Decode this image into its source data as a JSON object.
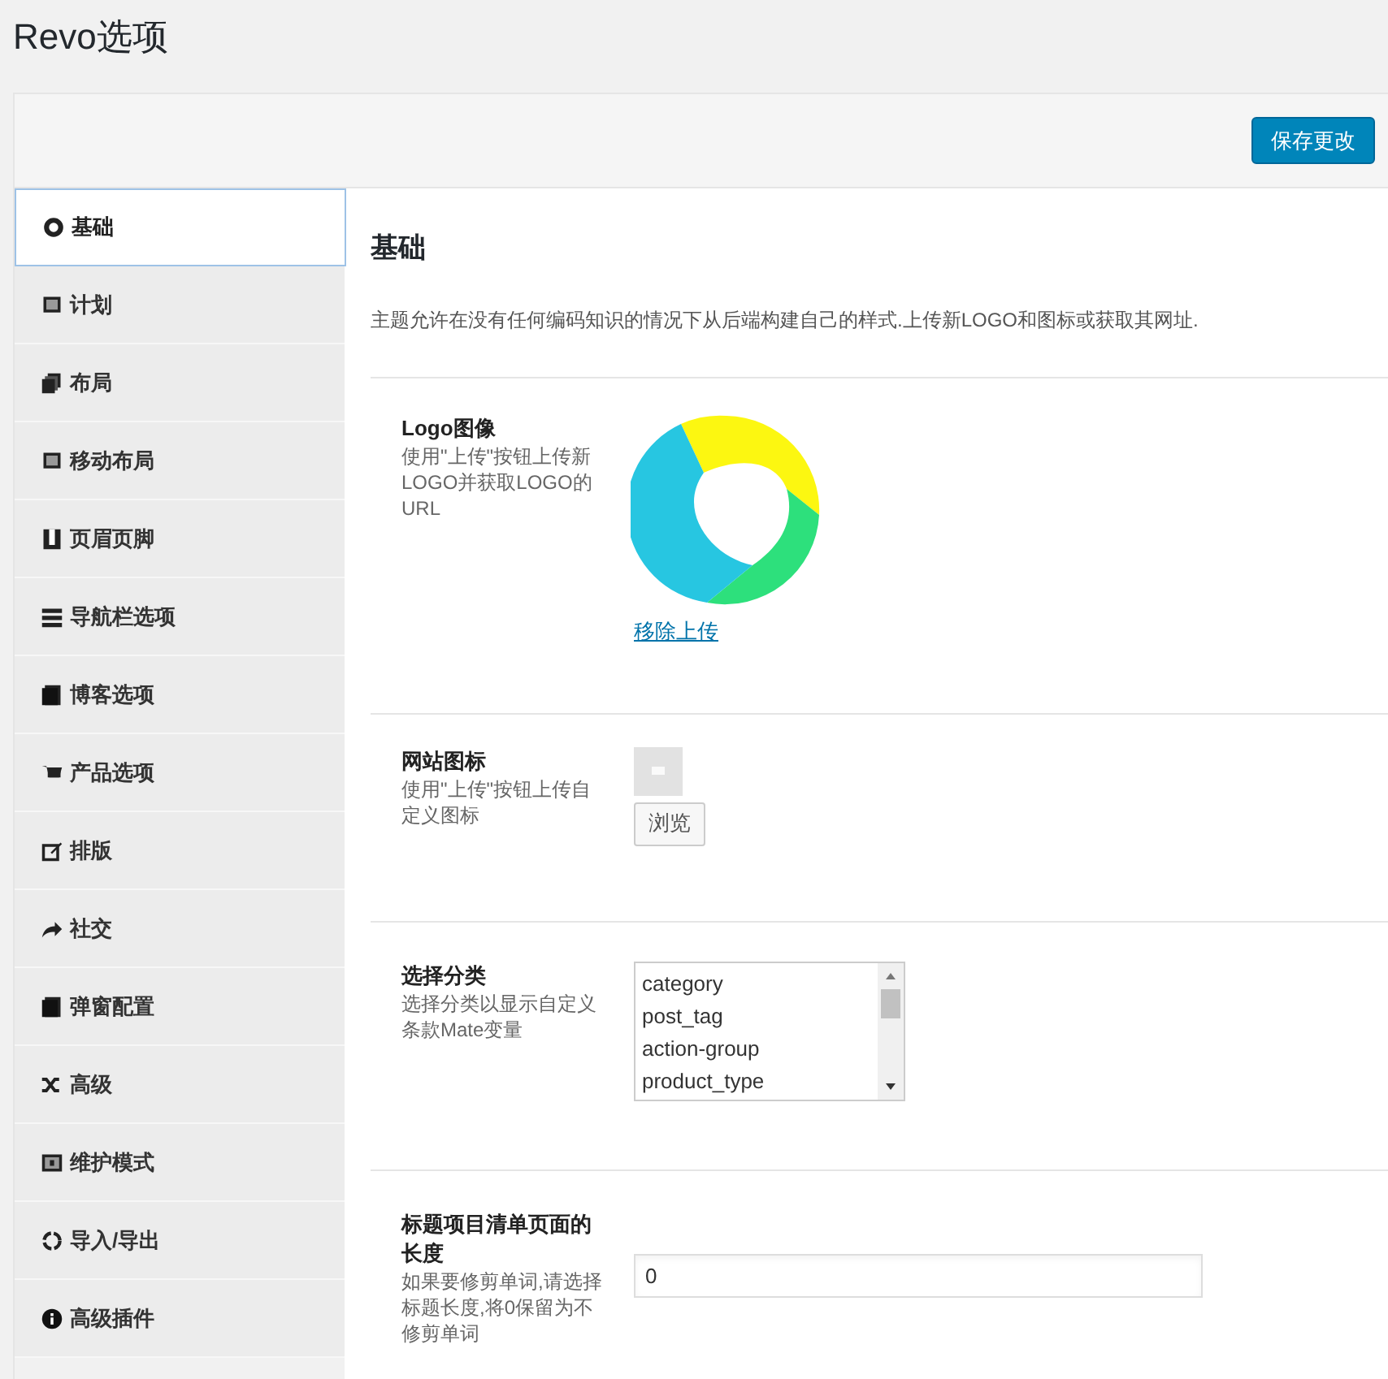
{
  "page_title": "Revo选项",
  "save_button": "保存更改",
  "sidebar": {
    "items": [
      {
        "label": "基础",
        "selected": true
      },
      {
        "label": "计划",
        "selected": false
      },
      {
        "label": "布局",
        "selected": false
      },
      {
        "label": "移动布局",
        "selected": false
      },
      {
        "label": "页眉页脚",
        "selected": false
      },
      {
        "label": "导航栏选项",
        "selected": false
      },
      {
        "label": "博客选项",
        "selected": false
      },
      {
        "label": "产品选项",
        "selected": false
      },
      {
        "label": "排版",
        "selected": false
      },
      {
        "label": "社交",
        "selected": false
      },
      {
        "label": "弹窗配置",
        "selected": false
      },
      {
        "label": "高级",
        "selected": false
      },
      {
        "label": "维护模式",
        "selected": false
      },
      {
        "label": "导入/导出",
        "selected": false
      },
      {
        "label": "高级插件",
        "selected": false
      }
    ]
  },
  "section": {
    "title": "基础",
    "description": "主题允许在没有任何编码知识的情况下从后端构建自己的样式.上传新LOGO和图标或获取其网址.",
    "fields": [
      {
        "kind": "logo",
        "label": "Logo图像",
        "help": "使用\"上传\"按钮上传新LOGO并获取LOGO的URL",
        "link": "移除上传"
      },
      {
        "kind": "favicon",
        "label": "网站图标",
        "help": "使用\"上传\"按钮上传自定义图标",
        "button": "浏览"
      },
      {
        "kind": "listbox",
        "label": "选择分类",
        "help": "选择分类以显示自定义条款Mate变量",
        "options": [
          "category",
          "post_tag",
          "action-group",
          "product_type"
        ]
      },
      {
        "kind": "text",
        "label": "标题项目清单页面的长度",
        "help": "如果要修剪单词,请选择标题长度,将0保留为不修剪单词",
        "value": "0"
      }
    ]
  }
}
